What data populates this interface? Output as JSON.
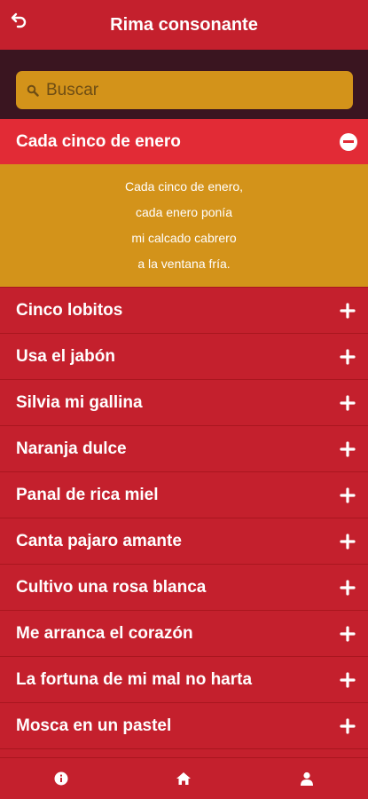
{
  "header": {
    "title": "Rima consonante",
    "back_icon": "back-arrow-icon"
  },
  "search": {
    "placeholder": "Buscar",
    "value": "",
    "icon": "search-icon"
  },
  "list": {
    "expanded": {
      "title": "Cada cinco de enero",
      "icon": "minus-icon",
      "lines": [
        "Cada cinco de enero,",
        "cada enero ponía",
        "mi calcado cabrero",
        "a la ventana fría."
      ]
    },
    "items": [
      {
        "title": "Cinco lobitos",
        "icon": "plus-icon"
      },
      {
        "title": "Usa el jabón",
        "icon": "plus-icon"
      },
      {
        "title": "Silvia mi gallina",
        "icon": "plus-icon"
      },
      {
        "title": "Naranja dulce",
        "icon": "plus-icon"
      },
      {
        "title": "Panal de rica miel",
        "icon": "plus-icon"
      },
      {
        "title": "Canta pajaro amante",
        "icon": "plus-icon"
      },
      {
        "title": "Cultivo una rosa blanca",
        "icon": "plus-icon"
      },
      {
        "title": "Me arranca el corazón",
        "icon": "plus-icon"
      },
      {
        "title": "La fortuna de mi mal no harta",
        "icon": "plus-icon"
      },
      {
        "title": "Mosca en un pastel",
        "icon": "plus-icon"
      }
    ]
  },
  "bottom_nav": [
    {
      "icon": "info-icon"
    },
    {
      "icon": "home-icon"
    },
    {
      "icon": "user-icon"
    }
  ],
  "colors": {
    "primary": "#c4202d",
    "active_row": "#e22b36",
    "accent": "#d3931a",
    "search_band": "#3a1520"
  }
}
